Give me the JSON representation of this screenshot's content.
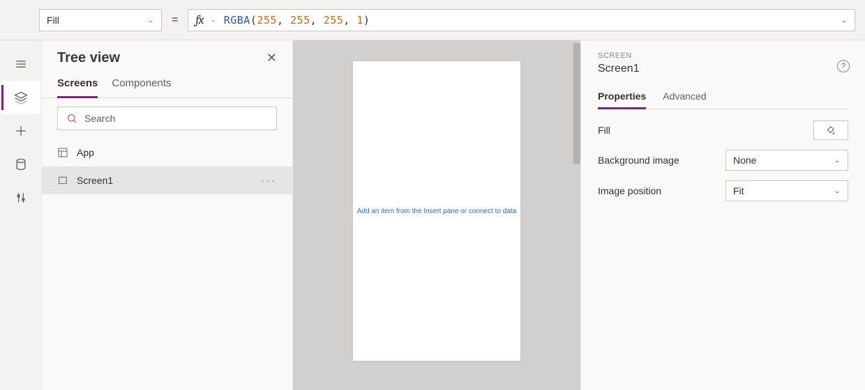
{
  "formulaBar": {
    "property": "Fill",
    "fxLabel": "fx",
    "equals": "=",
    "fn": "RGBA",
    "open": "(",
    "n1": "255",
    "c": ", ",
    "n2": "255",
    "n3": "255",
    "n4": "1",
    "close": ")"
  },
  "rail": {
    "items": [
      "menu",
      "treeview",
      "insert",
      "data",
      "tools"
    ]
  },
  "tree": {
    "title": "Tree view",
    "tab_screens": "Screens",
    "tab_components": "Components",
    "search_placeholder": "Search",
    "items": [
      {
        "label": "App",
        "icon": "app"
      },
      {
        "label": "Screen1",
        "icon": "screen",
        "selected": true
      }
    ]
  },
  "canvas": {
    "hint": "Add an item from the Insert pane or connect to data"
  },
  "props": {
    "crumb": "SCREEN",
    "obj_name": "Screen1",
    "tab_properties": "Properties",
    "tab_advanced": "Advanced",
    "rows": {
      "fill": {
        "label": "Fill"
      },
      "bg": {
        "label": "Background image",
        "value": "None"
      },
      "pos": {
        "label": "Image position",
        "value": "Fit"
      }
    }
  }
}
